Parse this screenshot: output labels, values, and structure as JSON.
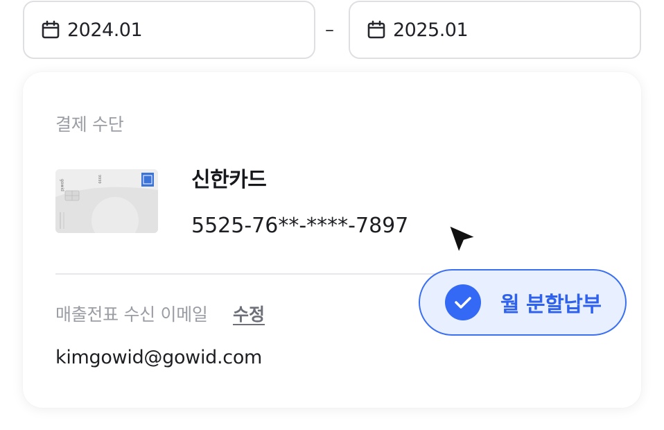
{
  "date_range": {
    "from": "2024.01",
    "separator": "–",
    "to": "2025.01",
    "icon": "calendar-icon"
  },
  "payment": {
    "section_label": "결제 수단",
    "card": {
      "name": "신한카드",
      "number": "5525-76**-****-7897",
      "image_brand_text": "gowid",
      "image_number_text": "9999"
    }
  },
  "email": {
    "label": "매출전표 수신 이메일",
    "edit_label": "수정",
    "value": "kimgowid@gowid.com"
  },
  "installment": {
    "label": "월 분할납부",
    "checked": true,
    "icon": "check-icon"
  },
  "cursor_icon": "pointer-cursor-icon",
  "colors": {
    "accent": "#3469f5",
    "accent_light": "#e8efff",
    "muted_text": "#9a9da4",
    "border": "#dedfe2"
  }
}
